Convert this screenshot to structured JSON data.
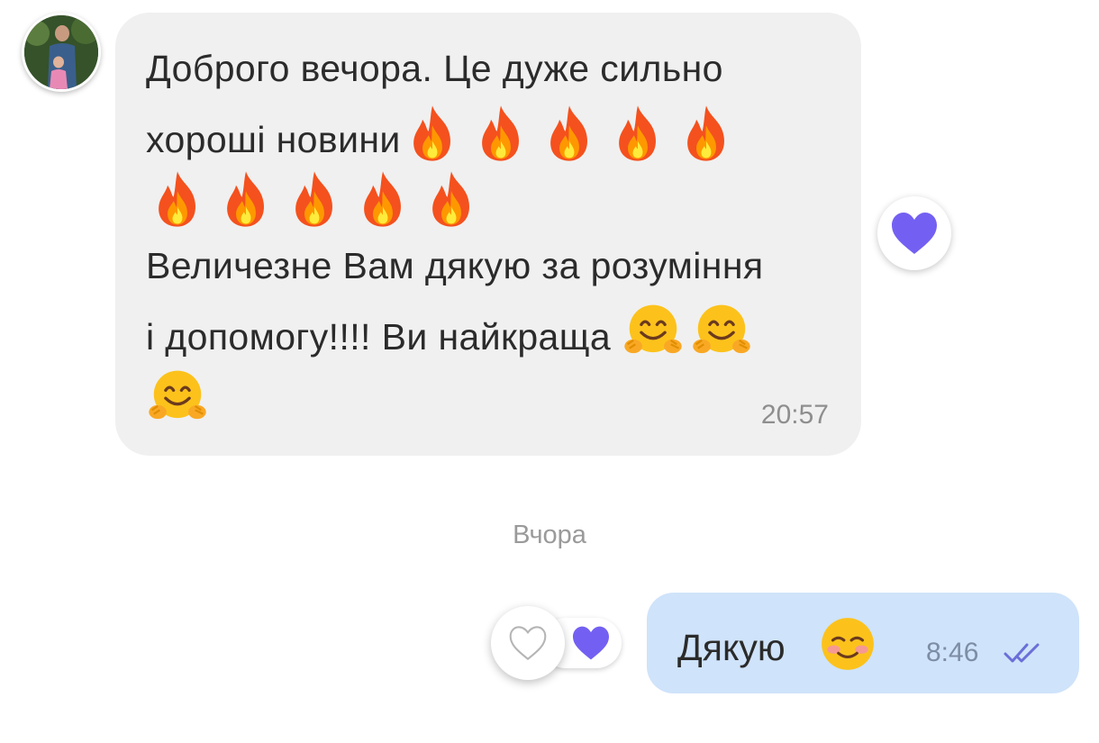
{
  "incoming": {
    "lines": [
      "Доброго вечора. Це дуже сильно",
      "хороші новини",
      "",
      "Величезне Вам дякую за розуміння",
      "і допомогу!!!! Ви найкраща",
      ""
    ],
    "time": "20:57",
    "reaction_icon": "heart-icon"
  },
  "divider": {
    "label": "Вчора"
  },
  "outgoing": {
    "text": "Дякую",
    "time": "8:46",
    "status_icon": "double-check-icon",
    "reaction_icon": "heart-icon"
  },
  "colors": {
    "incoming_bubble": "#f0f0f0",
    "outgoing_bubble": "#cfe3fa",
    "heart": "#7360f2",
    "time_text": "#8e8e8e"
  }
}
